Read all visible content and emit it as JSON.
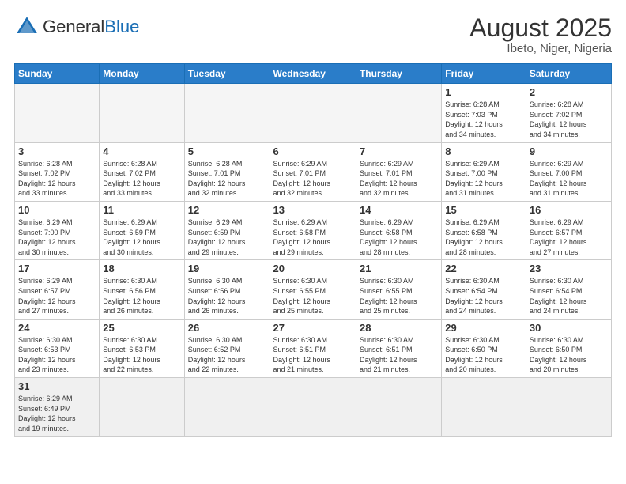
{
  "header": {
    "logo_general": "General",
    "logo_blue": "Blue",
    "title": "August 2025",
    "subtitle": "Ibeto, Niger, Nigeria"
  },
  "weekdays": [
    "Sunday",
    "Monday",
    "Tuesday",
    "Wednesday",
    "Thursday",
    "Friday",
    "Saturday"
  ],
  "weeks": [
    [
      {
        "day": "",
        "info": ""
      },
      {
        "day": "",
        "info": ""
      },
      {
        "day": "",
        "info": ""
      },
      {
        "day": "",
        "info": ""
      },
      {
        "day": "",
        "info": ""
      },
      {
        "day": "1",
        "info": "Sunrise: 6:28 AM\nSunset: 7:03 PM\nDaylight: 12 hours\nand 34 minutes."
      },
      {
        "day": "2",
        "info": "Sunrise: 6:28 AM\nSunset: 7:02 PM\nDaylight: 12 hours\nand 34 minutes."
      }
    ],
    [
      {
        "day": "3",
        "info": "Sunrise: 6:28 AM\nSunset: 7:02 PM\nDaylight: 12 hours\nand 33 minutes."
      },
      {
        "day": "4",
        "info": "Sunrise: 6:28 AM\nSunset: 7:02 PM\nDaylight: 12 hours\nand 33 minutes."
      },
      {
        "day": "5",
        "info": "Sunrise: 6:28 AM\nSunset: 7:01 PM\nDaylight: 12 hours\nand 32 minutes."
      },
      {
        "day": "6",
        "info": "Sunrise: 6:29 AM\nSunset: 7:01 PM\nDaylight: 12 hours\nand 32 minutes."
      },
      {
        "day": "7",
        "info": "Sunrise: 6:29 AM\nSunset: 7:01 PM\nDaylight: 12 hours\nand 32 minutes."
      },
      {
        "day": "8",
        "info": "Sunrise: 6:29 AM\nSunset: 7:00 PM\nDaylight: 12 hours\nand 31 minutes."
      },
      {
        "day": "9",
        "info": "Sunrise: 6:29 AM\nSunset: 7:00 PM\nDaylight: 12 hours\nand 31 minutes."
      }
    ],
    [
      {
        "day": "10",
        "info": "Sunrise: 6:29 AM\nSunset: 7:00 PM\nDaylight: 12 hours\nand 30 minutes."
      },
      {
        "day": "11",
        "info": "Sunrise: 6:29 AM\nSunset: 6:59 PM\nDaylight: 12 hours\nand 30 minutes."
      },
      {
        "day": "12",
        "info": "Sunrise: 6:29 AM\nSunset: 6:59 PM\nDaylight: 12 hours\nand 29 minutes."
      },
      {
        "day": "13",
        "info": "Sunrise: 6:29 AM\nSunset: 6:58 PM\nDaylight: 12 hours\nand 29 minutes."
      },
      {
        "day": "14",
        "info": "Sunrise: 6:29 AM\nSunset: 6:58 PM\nDaylight: 12 hours\nand 28 minutes."
      },
      {
        "day": "15",
        "info": "Sunrise: 6:29 AM\nSunset: 6:58 PM\nDaylight: 12 hours\nand 28 minutes."
      },
      {
        "day": "16",
        "info": "Sunrise: 6:29 AM\nSunset: 6:57 PM\nDaylight: 12 hours\nand 27 minutes."
      }
    ],
    [
      {
        "day": "17",
        "info": "Sunrise: 6:29 AM\nSunset: 6:57 PM\nDaylight: 12 hours\nand 27 minutes."
      },
      {
        "day": "18",
        "info": "Sunrise: 6:30 AM\nSunset: 6:56 PM\nDaylight: 12 hours\nand 26 minutes."
      },
      {
        "day": "19",
        "info": "Sunrise: 6:30 AM\nSunset: 6:56 PM\nDaylight: 12 hours\nand 26 minutes."
      },
      {
        "day": "20",
        "info": "Sunrise: 6:30 AM\nSunset: 6:55 PM\nDaylight: 12 hours\nand 25 minutes."
      },
      {
        "day": "21",
        "info": "Sunrise: 6:30 AM\nSunset: 6:55 PM\nDaylight: 12 hours\nand 25 minutes."
      },
      {
        "day": "22",
        "info": "Sunrise: 6:30 AM\nSunset: 6:54 PM\nDaylight: 12 hours\nand 24 minutes."
      },
      {
        "day": "23",
        "info": "Sunrise: 6:30 AM\nSunset: 6:54 PM\nDaylight: 12 hours\nand 24 minutes."
      }
    ],
    [
      {
        "day": "24",
        "info": "Sunrise: 6:30 AM\nSunset: 6:53 PM\nDaylight: 12 hours\nand 23 minutes."
      },
      {
        "day": "25",
        "info": "Sunrise: 6:30 AM\nSunset: 6:53 PM\nDaylight: 12 hours\nand 22 minutes."
      },
      {
        "day": "26",
        "info": "Sunrise: 6:30 AM\nSunset: 6:52 PM\nDaylight: 12 hours\nand 22 minutes."
      },
      {
        "day": "27",
        "info": "Sunrise: 6:30 AM\nSunset: 6:51 PM\nDaylight: 12 hours\nand 21 minutes."
      },
      {
        "day": "28",
        "info": "Sunrise: 6:30 AM\nSunset: 6:51 PM\nDaylight: 12 hours\nand 21 minutes."
      },
      {
        "day": "29",
        "info": "Sunrise: 6:30 AM\nSunset: 6:50 PM\nDaylight: 12 hours\nand 20 minutes."
      },
      {
        "day": "30",
        "info": "Sunrise: 6:30 AM\nSunset: 6:50 PM\nDaylight: 12 hours\nand 20 minutes."
      }
    ],
    [
      {
        "day": "31",
        "info": "Sunrise: 6:29 AM\nSunset: 6:49 PM\nDaylight: 12 hours\nand 19 minutes."
      },
      {
        "day": "",
        "info": ""
      },
      {
        "day": "",
        "info": ""
      },
      {
        "day": "",
        "info": ""
      },
      {
        "day": "",
        "info": ""
      },
      {
        "day": "",
        "info": ""
      },
      {
        "day": "",
        "info": ""
      }
    ]
  ]
}
